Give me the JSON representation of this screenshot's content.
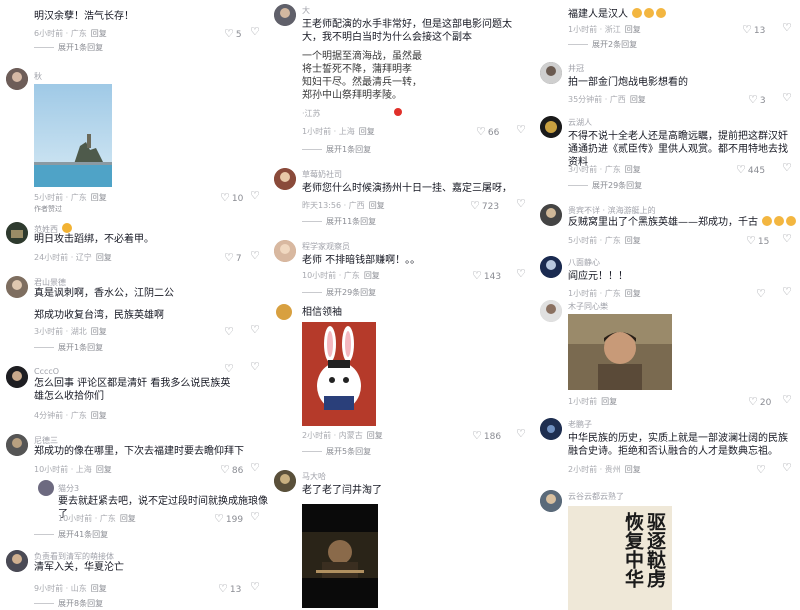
{
  "col1": {
    "c0": {
      "user": "",
      "text": "明汉余孽！浩气长存！",
      "meta": "6小时前 · 广东",
      "reply": "回复",
      "likes": "5",
      "expand": "展开1条回复"
    },
    "c1": {
      "user": "秋",
      "text": "",
      "meta": "5小时前 · 广东",
      "reply": "回复",
      "likes": "10",
      "author_tag": "作者赞过"
    },
    "c2": {
      "user": "范姓西",
      "text": "明日攻击蹈绑，不必着甲。",
      "meta": "24小时前 · 辽宁",
      "reply": "回复",
      "likes": "7"
    },
    "c3": {
      "user": "君山景德",
      "text": "真是讽刺啊，香水公，江阴二公",
      "meta": "",
      "reply": "",
      "likes": ""
    },
    "c4": {
      "user": "",
      "text": "郑成功收复台湾，民族英雄啊",
      "meta": "3小时前 · 湖北",
      "reply": "回复",
      "likes": "",
      "expand": "展开1条回复"
    },
    "c5": {
      "user": "CcccO",
      "text": "怎么回事 评论区都是清奸 看我多么说民族英雄怎么收拾你们",
      "meta": "4分钟前 · 广东",
      "reply": "回复",
      "likes": ""
    },
    "c6": {
      "user": "尼德三",
      "text": "郑成功的像在哪里，下次去福建时要去瞻仰拜下",
      "meta": "10小时前 · 上海",
      "reply": "回复",
      "likes": "86"
    },
    "c6r": {
      "user": "猫分3",
      "text": "要去就赶紧去吧，说不定过段时间就换成施琅像了",
      "meta": "10小时前 · 广东",
      "reply": "回复",
      "likes": "199",
      "expand": "展开41条回复"
    },
    "c7": {
      "user": "负责看到清军的萌接体",
      "text": "清军入关，华夏沦亡",
      "meta": "9小时前 · 山东",
      "reply": "回复",
      "likes": "13",
      "expand": "展开8条回复"
    }
  },
  "col2": {
    "c0": {
      "user": "大",
      "text": "王老师配演的水手非常好，但是这部电影问题太大，我不明白当时为什么会接这个副本",
      "quote": "一个明据至滴海战，虽然最\n将士誓死不降，蒲拜明孝\n知妇干尽。然最清兵一转，\n郑孙中山祭拜明孝陵。",
      "meta": "·江苏",
      "meta2": "1小时前 · 上海",
      "reply": "回复",
      "likes": "66",
      "expand": "展开1条回复"
    },
    "c1": {
      "user": "草莓奶社司",
      "text": "老师您什么时候演扬州十日一挂、嘉定三屠呀，",
      "meta": "昨天13:56 · 广西",
      "reply": "回复",
      "likes": "723",
      "expand": "展开11条回复"
    },
    "c2": {
      "user": "程学家观察员",
      "text": "老师 不排暗钱部赚啊！。。",
      "meta": "10小时前 · 广东",
      "reply": "回复",
      "likes": "143",
      "expand": "展开29条回复"
    },
    "c3": {
      "user": "",
      "text": "相信领袖",
      "meta": "2小时前 · 内蒙古",
      "reply": "回复",
      "likes": "186",
      "expand": "展开5条回复"
    },
    "c4": {
      "user": "马大哈",
      "text": "老了老了闫井淘了",
      "meta": "",
      "reply": "",
      "likes": ""
    }
  },
  "col3": {
    "c0": {
      "user": "",
      "text": "福建人是汉人",
      "meta": "1小时前 · 浙江",
      "reply": "回复",
      "likes": "13",
      "expand": "展开2条回复"
    },
    "c1": {
      "user": "井冠",
      "text": "拍一部金门炮战电影想看的",
      "meta": "35分钟前 · 广西",
      "reply": "回复",
      "likes": "3"
    },
    "c2": {
      "user": "云湖人",
      "text": "不得不说十全老人还是高瞻远瞩，提前把这群汉奸通通扔进《贰臣传》里供人观赏。都不用特地去找资料",
      "meta": "3小时前 · 广东",
      "reply": "回复",
      "likes": "445",
      "expand": "展开29条回复"
    },
    "c3": {
      "user": "贵宾不详 · 滨海游艇上的",
      "text": "反贼窝里出了个黑族英雄——郑成功，千古",
      "meta": "5小时前 · 广东",
      "reply": "回复",
      "likes": "15"
    },
    "c4": {
      "user": "八面静心",
      "text": "阎应元！！！",
      "meta": "1小时前 · 广东",
      "reply": "回复",
      "likes": ""
    },
    "c5": {
      "user": "木子同心樂",
      "text": "",
      "meta": "1小时前",
      "reply": "回复",
      "likes": "20"
    },
    "c6": {
      "user": "老鹏子",
      "text": "中华民族的历史，实质上就是一部波澜壮阔的民族融合史诗。拒绝和否认融合的人才是数典忘祖。",
      "meta": "2小时前 · 贵州",
      "reply": "回复",
      "likes": ""
    },
    "c7": {
      "user": "云谷云都云熟了",
      "text": "",
      "calligraphy": "驱逐鞑虏 恢复中华",
      "meta": "",
      "reply": "",
      "likes": ""
    }
  },
  "icons": {
    "heart": "heart-icon",
    "dislike": "dislike-icon"
  },
  "colors": {
    "text": "#161823",
    "meta": "#a8aab0",
    "heart": "#8a8c93",
    "bg": "#ffffff"
  }
}
